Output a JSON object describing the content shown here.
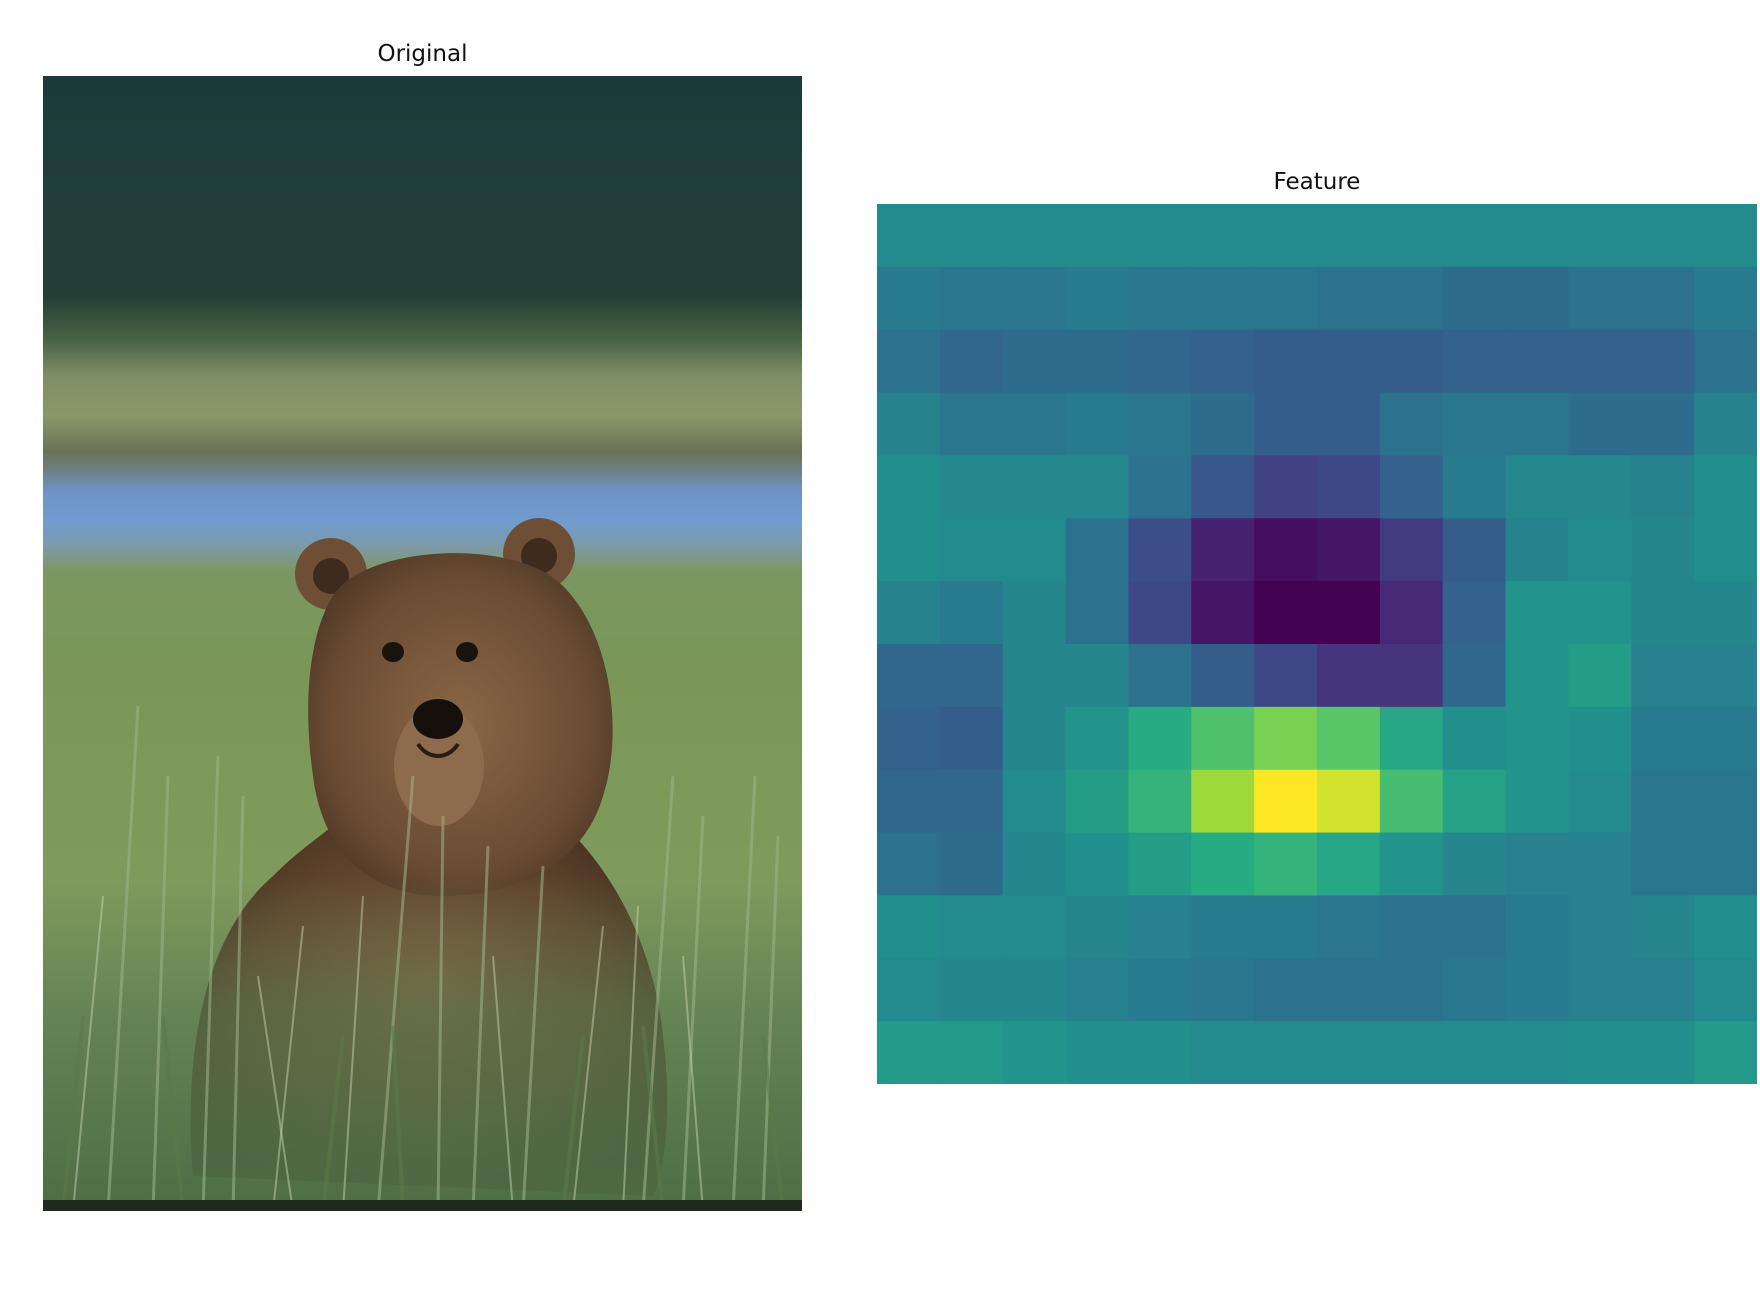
{
  "titles": {
    "original": "Original",
    "feature": "Feature"
  },
  "feature_map": {
    "colormap": "viridis",
    "rows": 14,
    "cols": 14,
    "values": [
      [
        0.48,
        0.48,
        0.48,
        0.48,
        0.48,
        0.48,
        0.48,
        0.48,
        0.48,
        0.48,
        0.48,
        0.48,
        0.48,
        0.48
      ],
      [
        0.42,
        0.4,
        0.4,
        0.42,
        0.4,
        0.4,
        0.4,
        0.38,
        0.38,
        0.36,
        0.36,
        0.38,
        0.38,
        0.42
      ],
      [
        0.38,
        0.34,
        0.36,
        0.36,
        0.34,
        0.32,
        0.3,
        0.3,
        0.3,
        0.32,
        0.32,
        0.32,
        0.32,
        0.38
      ],
      [
        0.45,
        0.4,
        0.4,
        0.42,
        0.4,
        0.36,
        0.3,
        0.3,
        0.38,
        0.4,
        0.4,
        0.36,
        0.36,
        0.45
      ],
      [
        0.5,
        0.47,
        0.47,
        0.47,
        0.38,
        0.28,
        0.2,
        0.22,
        0.32,
        0.42,
        0.47,
        0.47,
        0.45,
        0.5
      ],
      [
        0.5,
        0.48,
        0.48,
        0.38,
        0.24,
        0.1,
        0.04,
        0.06,
        0.18,
        0.3,
        0.45,
        0.48,
        0.46,
        0.5
      ],
      [
        0.45,
        0.42,
        0.46,
        0.38,
        0.22,
        0.06,
        0.0,
        0.0,
        0.12,
        0.32,
        0.52,
        0.52,
        0.46,
        0.46
      ],
      [
        0.34,
        0.34,
        0.46,
        0.46,
        0.38,
        0.3,
        0.22,
        0.16,
        0.16,
        0.34,
        0.52,
        0.56,
        0.44,
        0.44
      ],
      [
        0.32,
        0.3,
        0.46,
        0.52,
        0.62,
        0.72,
        0.8,
        0.74,
        0.6,
        0.5,
        0.52,
        0.5,
        0.42,
        0.42
      ],
      [
        0.34,
        0.34,
        0.48,
        0.56,
        0.66,
        0.86,
        1.0,
        0.94,
        0.7,
        0.58,
        0.52,
        0.48,
        0.4,
        0.4
      ],
      [
        0.38,
        0.36,
        0.46,
        0.5,
        0.56,
        0.62,
        0.66,
        0.6,
        0.52,
        0.46,
        0.44,
        0.44,
        0.4,
        0.4
      ],
      [
        0.5,
        0.48,
        0.48,
        0.46,
        0.44,
        0.42,
        0.42,
        0.4,
        0.38,
        0.38,
        0.42,
        0.44,
        0.46,
        0.5
      ],
      [
        0.48,
        0.46,
        0.46,
        0.44,
        0.42,
        0.4,
        0.38,
        0.38,
        0.38,
        0.4,
        0.42,
        0.44,
        0.44,
        0.48
      ],
      [
        0.54,
        0.54,
        0.52,
        0.5,
        0.5,
        0.48,
        0.48,
        0.48,
        0.48,
        0.48,
        0.48,
        0.5,
        0.5,
        0.54
      ]
    ]
  }
}
